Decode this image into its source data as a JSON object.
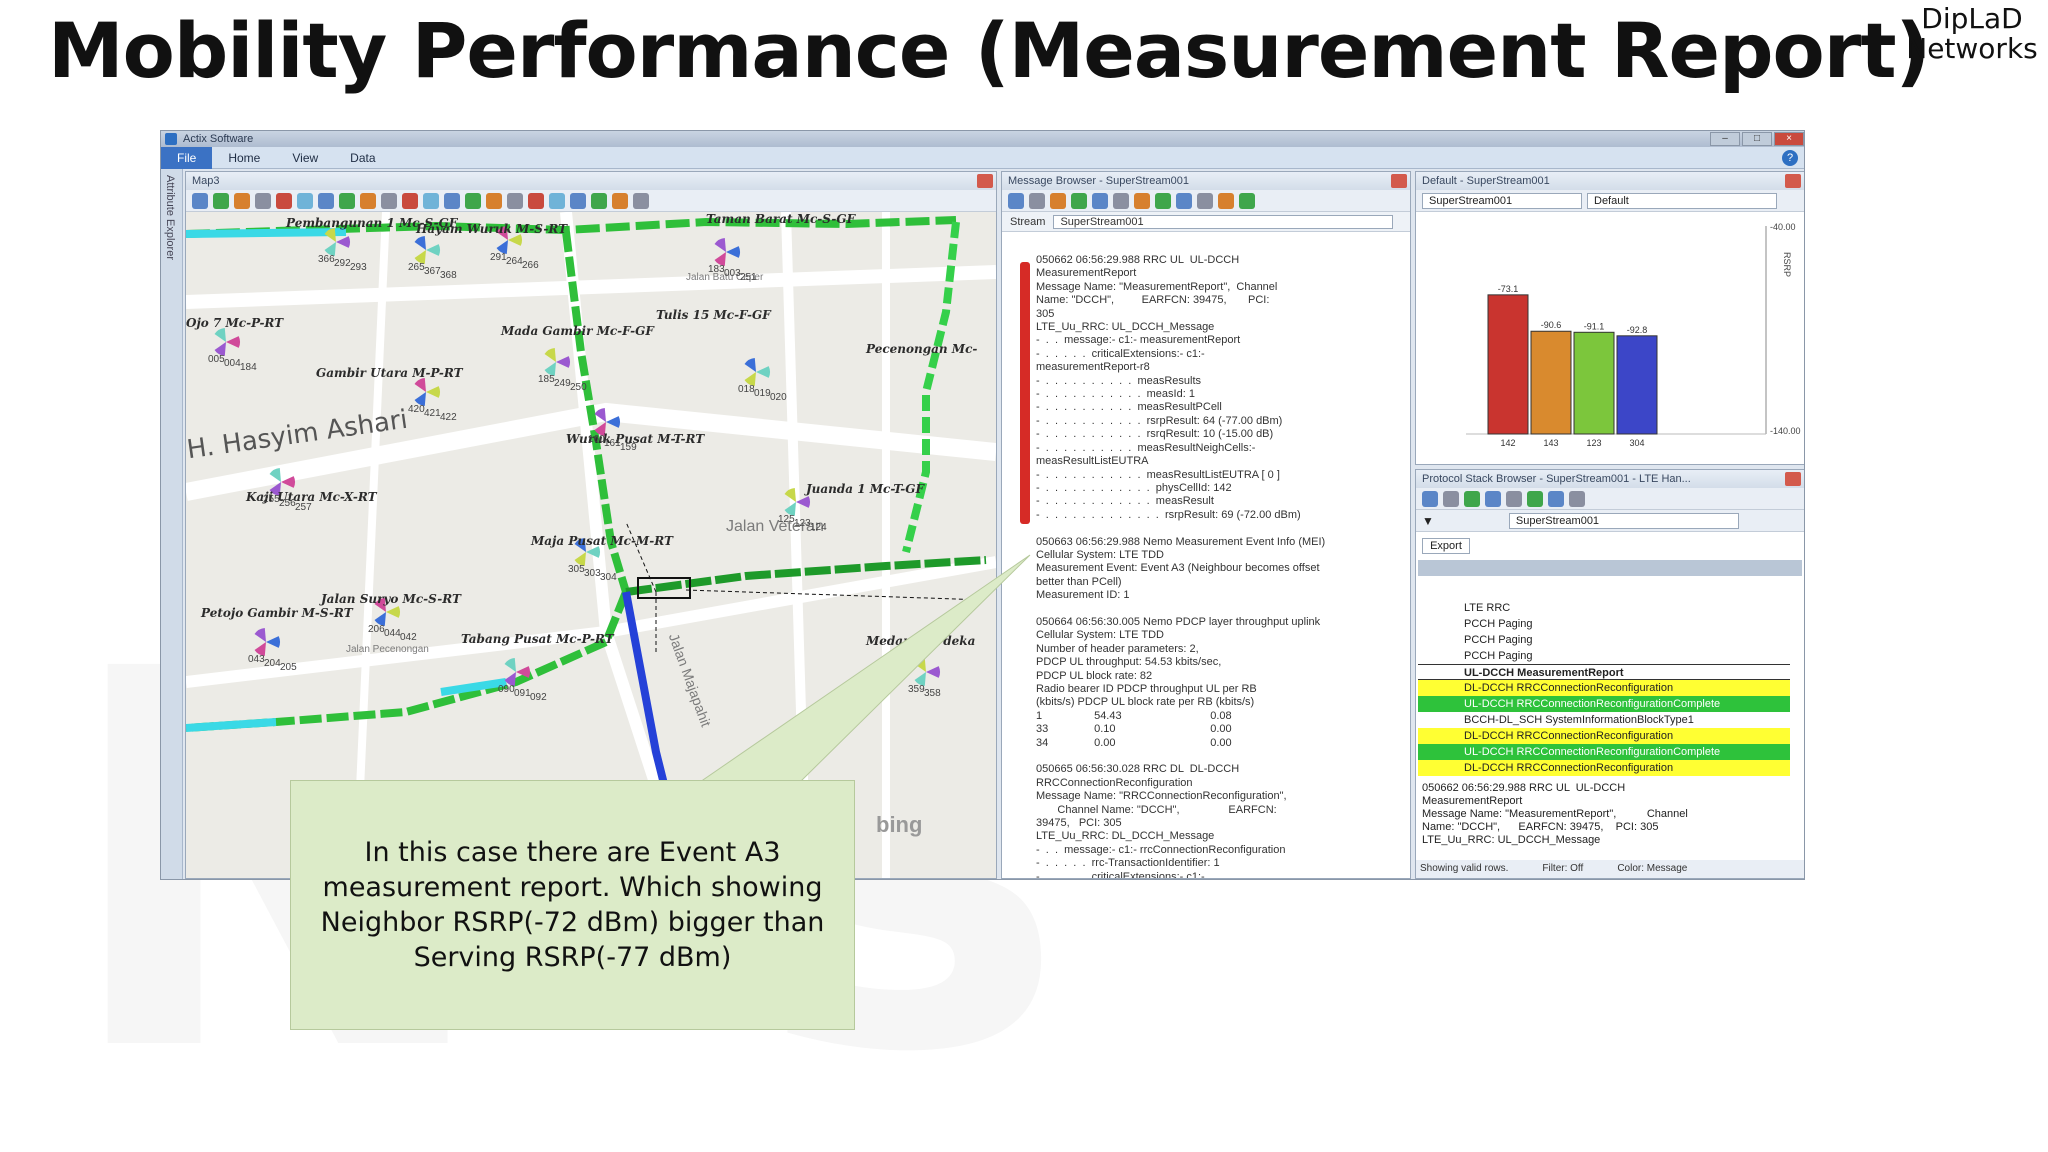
{
  "slide": {
    "title": "Mobility Performance (Measurement Report)",
    "logo_line1": "DipLaD",
    "logo_line2": "Networks",
    "watermark": "N  s"
  },
  "window": {
    "title": "Actix Software",
    "controls": [
      "–",
      "□",
      "×"
    ],
    "ribbon": [
      "File",
      "Home",
      "View",
      "Data"
    ],
    "side_tab": "Attribute Explorer"
  },
  "map": {
    "panel_title": "Map3",
    "sites": [
      "Pembangunan 1 Mc-S-GF",
      "Hayam Wuruk M-S-RT",
      "Taman Barat Mc-S-GF",
      "Tulis 15 Mc-F-GF",
      "Mada Gambir Mc-F-GF",
      "Pecenongan Mc-",
      "Ojo 7 Mc-P-RT",
      "Gambir Utara M-P-RT",
      "Wuruk Pusat M-T-RT",
      "Kaji Utara Mc-X-RT",
      "Juanda 1 Mc-T-GF",
      "Maja Pusat Mc-M-RT",
      "Jalan Suryo Mc-S-RT",
      "Petojo Gambir M-S-RT",
      "Tabang Pusat Mc-P-RT",
      "Medan Merdeka"
    ],
    "big_road": "H. Hasyim Ashari",
    "roads": [
      "Jalan Veteran",
      "Jalan Batu Ceper",
      "Jalan Majapahit",
      "Jalan Pecenongan"
    ],
    "cell_ids": [
      "366",
      "292",
      "293",
      "265",
      "367",
      "368",
      "291",
      "264",
      "266",
      "183",
      "003",
      "251",
      "005",
      "004",
      "184",
      "185",
      "249",
      "250",
      "018",
      "019",
      "020",
      "420",
      "421",
      "422",
      "160",
      "161",
      "159",
      "255",
      "256",
      "257",
      "125",
      "123",
      "124",
      "305",
      "303",
      "304",
      "206",
      "044",
      "042",
      "043",
      "204",
      "205",
      "090",
      "091",
      "092",
      "359",
      "358"
    ],
    "bing": "bing"
  },
  "messages": {
    "panel_title": "Message Browser - SuperStream001",
    "stream_label": "Stream",
    "stream_value": "SuperStream001",
    "text": "050662 06:56:29.988 RRC UL  UL-DCCH\nMeasurementReport\nMessage Name: \"MeasurementReport\",  Channel\nName: \"DCCH\",         EARFCN: 39475,       PCI:\n305\nLTE_Uu_RRC: UL_DCCH_Message\n-  .  .  message:- c1:- measurementReport\n-  .  .  .  .  .  criticalExtensions:- c1:-\nmeasurementReport-r8\n-  .  .  .  .  .  .  .  .  .  .  measResults\n-  .  .  .  .  .  .  .  .  .  .  .  measId: 1\n-  .  .  .  .  .  .  .  .  .  .  measResultPCell\n-  .  .  .  .  .  .  .  .  .  .  .  rsrpResult: 64 (-77.00 dBm)\n-  .  .  .  .  .  .  .  .  .  .  .  rsrqResult: 10 (-15.00 dB)\n-  .  .  .  .  .  .  .  .  .  .  measResultNeighCells:-\nmeasResultListEUTRA\n-  .  .  .  .  .  .  .  .  .  .  .  measResultListEUTRA [ 0 ]\n-  .  .  .  .  .  .  .  .  .  .  .  .  physCellId: 142\n-  .  .  .  .  .  .  .  .  .  .  .  .  measResult\n-  .  .  .  .  .  .  .  .  .  .  .  .  .  rsrpResult: 69 (-72.00 dBm)\n\n050663 06:56:29.988 Nemo Measurement Event Info (MEI)\nCellular System: LTE TDD\nMeasurement Event: Event A3 (Neighbour becomes offset\nbetter than PCell)\nMeasurement ID: 1\n\n050664 06:56:30.005 Nemo PDCP layer throughput uplink\nCellular System: LTE TDD\nNumber of header parameters: 2,\nPDCP UL throughput: 54.53 kbits/sec,\nPDCP UL block rate: 82\nRadio bearer ID PDCP throughput UL per RB\n(kbits/s) PDCP UL block rate per RB (kbits/s)\n1                 54.43                             0.08\n33               0.10                               0.00\n34               0.00                               0.00\n\n050665 06:56:30.028 RRC DL  DL-DCCH\nRRCConnectionReconfiguration\nMessage Name: \"RRCConnectionReconfiguration\",\n       Channel Name: \"DCCH\",                EARFCN:\n39475,   PCI: 305\nLTE_Uu_RRC: DL_DCCH_Message\n-  .  .  message:- c1:- rrcConnectionReconfiguration\n-  .  .  .  .  .  rrc-TransactionIdentifier: 1\n-  .  .  .  .  .  criticalExtensions:- c1:-"
  },
  "chart_panel": {
    "panel_title": "Default - SuperStream001",
    "stream_select": "SuperStream001",
    "view_select": "Default",
    "axis_label": "RSRP"
  },
  "chart_data": {
    "type": "bar",
    "categories": [
      "142",
      "143",
      "123",
      "304"
    ],
    "values": [
      -73.1,
      -90.6,
      -91.1,
      -92.8
    ],
    "value_labels": [
      "-73.1",
      "-90.6",
      "-91.1",
      "-92.8"
    ],
    "colors": [
      "#c9342f",
      "#d98a2e",
      "#7cc63c",
      "#3c46c8"
    ],
    "ylim": [
      -140,
      -40
    ],
    "ytick_labels": [
      "-40.00",
      "-140.00"
    ],
    "ylabel": "RSRP",
    "title": "",
    "xlabel": ""
  },
  "protocol": {
    "panel_title": "Protocol Stack Browser - SuperStream001 - LTE Han...",
    "stream_select": "SuperStream001",
    "export_label": "Export",
    "rows": [
      {
        "label": "LTE RRC",
        "style": ""
      },
      {
        "label": "PCCH Paging",
        "style": ""
      },
      {
        "label": "PCCH Paging",
        "style": ""
      },
      {
        "label": "PCCH Paging",
        "style": ""
      },
      {
        "label": "UL-DCCH MeasurementReport",
        "style": "sel"
      },
      {
        "label": "DL-DCCH  RRCConnectionReconfiguration",
        "style": "yellow"
      },
      {
        "label": "UL-DCCH  RRCConnectionReconfigurationComplete",
        "style": "green"
      },
      {
        "label": "BCCH-DL_SCH  SystemInformationBlockType1",
        "style": ""
      },
      {
        "label": "DL-DCCH  RRCConnectionReconfiguration",
        "style": "yellow"
      },
      {
        "label": "UL-DCCH  RRCConnectionReconfigurationComplete",
        "style": "green"
      },
      {
        "label": "DL-DCCH  RRCConnectionReconfiguration",
        "style": "yellow"
      }
    ],
    "detail": "050662 06:56:29.988 RRC UL  UL-DCCH\nMeasurementReport\nMessage Name: \"MeasurementReport\",          Channel\nName: \"DCCH\",      EARFCN: 39475,    PCI: 305\nLTE_Uu_RRC: UL_DCCH_Message",
    "status": [
      "Showing valid rows.",
      "Filter: Off",
      "Color: Message"
    ]
  },
  "callout": {
    "text": "In this case there are Event A3 measurement report. Which showing Neighbor RSRP(-72 dBm) bigger than Serving RSRP(-77 dBm)"
  },
  "colors": {
    "accent": "#3b72c4",
    "callout_bg": "#dcebc8"
  }
}
